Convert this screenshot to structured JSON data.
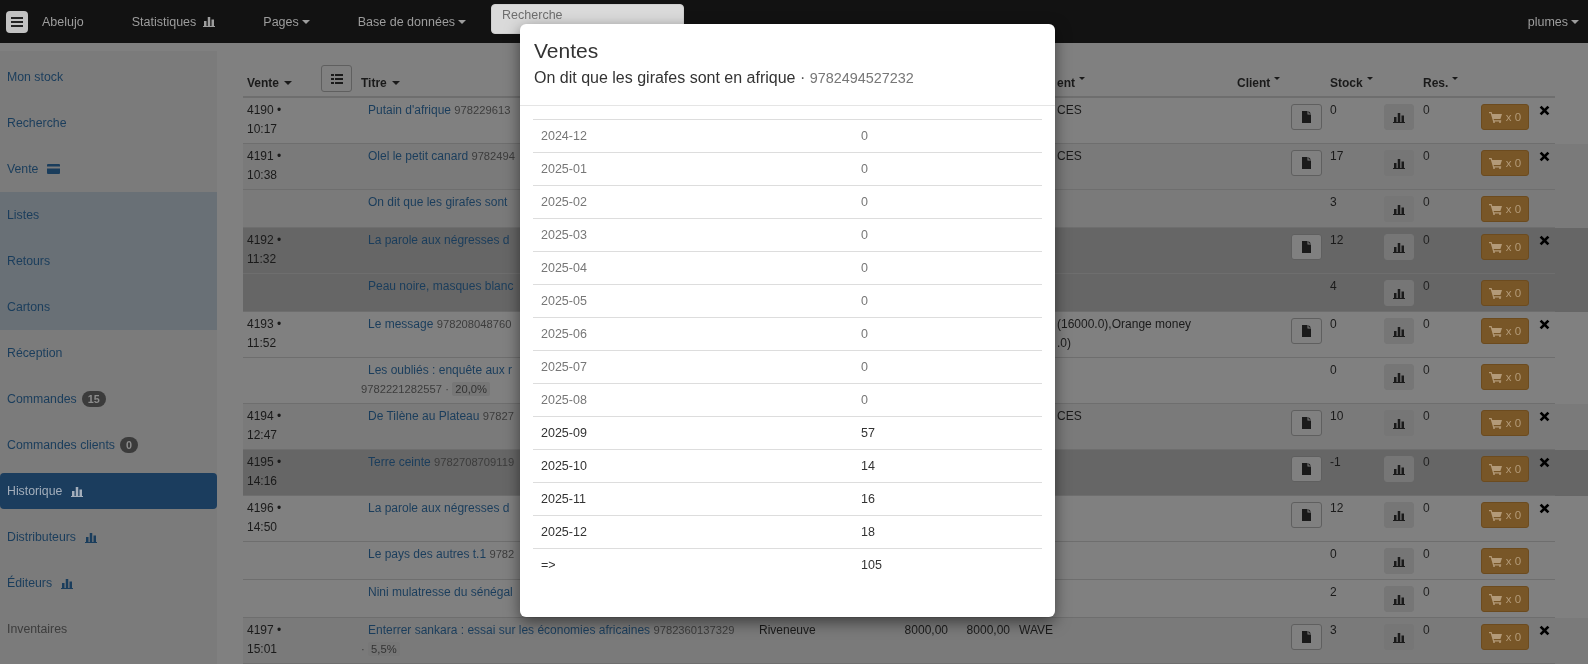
{
  "navbar": {
    "brand": "Abelujo",
    "items": [
      {
        "label": "Statistiques",
        "kind": "stats"
      },
      {
        "label": "Pages",
        "kind": "dropdown"
      },
      {
        "label": "Base de données",
        "kind": "dropdown"
      }
    ],
    "search": {
      "placeholder": "Recherche"
    },
    "user": {
      "label": "plumes"
    }
  },
  "sidebar": {
    "sections": [
      {
        "highlighted": false,
        "items": [
          {
            "label": "Mon stock",
            "kind": "plain",
            "selected": false,
            "disabled": false
          },
          {
            "label": "Recherche",
            "kind": "plain",
            "selected": false,
            "disabled": false
          },
          {
            "label": "Vente",
            "kind": "payment",
            "selected": false,
            "disabled": false
          }
        ]
      },
      {
        "highlighted": true,
        "items": [
          {
            "label": "Listes",
            "kind": "plain",
            "selected": false,
            "disabled": false
          },
          {
            "label": "Retours",
            "kind": "plain",
            "selected": false,
            "disabled": false
          },
          {
            "label": "Cartons",
            "kind": "plain",
            "selected": false,
            "disabled": false
          }
        ]
      },
      {
        "highlighted": false,
        "items": [
          {
            "label": "Réception",
            "kind": "plain",
            "selected": false,
            "disabled": false
          },
          {
            "label": "Commandes",
            "kind": "plain",
            "selected": false,
            "disabled": false,
            "badge": "15"
          },
          {
            "label": "Commandes clients",
            "kind": "plain",
            "selected": false,
            "disabled": false,
            "badge": "0"
          },
          {
            "label": "Historique",
            "kind": "stats",
            "selected": true,
            "disabled": false
          },
          {
            "label": "Distributeurs",
            "kind": "stats",
            "selected": false,
            "disabled": false
          },
          {
            "label": "Éditeurs",
            "kind": "stats",
            "selected": false,
            "disabled": false
          },
          {
            "label": "Inventaires",
            "kind": "plain",
            "selected": false,
            "disabled": true
          }
        ]
      }
    ]
  },
  "table": {
    "columns": [
      {
        "label": "Vente",
        "kind": "menu"
      },
      {
        "kind": "toggle"
      },
      {
        "label": "Titre",
        "kind": "menu"
      },
      {
        "label": "ent",
        "kind": "sort"
      },
      {
        "label": "Client",
        "kind": "sort"
      },
      {
        "label": "Stock",
        "kind": "sort"
      },
      {
        "label": "Res.",
        "kind": "sort"
      }
    ],
    "sales": [
      {
        "label": "4190 • 10:17",
        "color": "#808080",
        "payment": "CES",
        "items": [
          {
            "title": "Putain d'afrique",
            "isbn": "978229613",
            "stock": "0",
            "reserved": "0",
            "cart": "x 0"
          }
        ]
      },
      {
        "label": "4191 • 10:38",
        "color": "#7a7a7a",
        "payment": "CES",
        "items": [
          {
            "title": "Olel le petit canard",
            "isbn": "9782494",
            "stock": "17",
            "reserved": "0",
            "cart": "x 0"
          },
          {
            "title": "On dit que les girafes sont",
            "stock": "3",
            "reserved": "0",
            "cart": "x 0"
          }
        ]
      },
      {
        "label": "4192 • 11:32",
        "color": "#666666",
        "items": [
          {
            "title": "La parole aux négresses d",
            "stock": "12",
            "reserved": "0",
            "cart": "x 0"
          },
          {
            "title": "Peau noire, masques blanc",
            "stock": "4",
            "reserved": "0",
            "cart": "x 0"
          }
        ]
      },
      {
        "label": "4193 • 11:52",
        "color": "#808080",
        "payment": "(16000.0),Orange money\n.0)",
        "items": [
          {
            "title": "Le message",
            "isbn": "978208048760",
            "stock": "0",
            "reserved": "0",
            "cart": "x 0"
          },
          {
            "title": "Les oubliés : enquête aux r",
            "isbn": "9782221282557",
            "separator": "·",
            "discount": "20,0%",
            "stock": "0",
            "reserved": "0",
            "cart": "x 0"
          }
        ]
      },
      {
        "label": "4194 • 12:47",
        "color": "#7a7a7a",
        "payment": "CES",
        "items": [
          {
            "title": "De Tilène au Plateau",
            "isbn": "97827",
            "stock": "10",
            "reserved": "0",
            "cart": "x 0"
          }
        ]
      },
      {
        "label": "4195 • 14:16",
        "color": "#666666",
        "items": [
          {
            "title": "Terre ceinte",
            "isbn": "9782708709119",
            "stock": "-1",
            "reserved": "0",
            "cart": "x 0"
          }
        ]
      },
      {
        "label": "4196 • 14:50",
        "color": "#808080",
        "items": [
          {
            "title": "La parole aux négresses d",
            "stock": "12",
            "reserved": "0",
            "cart": "x 0"
          },
          {
            "title": "Le pays des autres t.1",
            "isbn": "9782",
            "stock": "0",
            "reserved": "0",
            "cart": "x 0"
          },
          {
            "title": "Nini mulatresse du sénégal",
            "stock": "2",
            "reserved": "0",
            "cart": "x 0"
          }
        ]
      },
      {
        "label": "4197 • 15:01",
        "color": "#7a7a7a",
        "publisher": "Riveneuve",
        "price": "8000,00",
        "total": "8000,00",
        "payment": "WAVE",
        "items": [
          {
            "title": "Enterrer sankara : essai sur les économies africaines",
            "isbn": "9782360137329",
            "separator": "·",
            "discount": "5,5%",
            "stock": "3",
            "reserved": "0",
            "cart": "x 0"
          }
        ]
      }
    ]
  },
  "modal": {
    "title": "Ventes",
    "subtitle": {
      "title": "On dit que les girafes sont en afrique",
      "separator": "·",
      "isbn": "9782494527232"
    },
    "rows": [
      {
        "month": "2024-12",
        "count": "0",
        "muted": true
      },
      {
        "month": "2025-01",
        "count": "0",
        "muted": true
      },
      {
        "month": "2025-02",
        "count": "0",
        "muted": true
      },
      {
        "month": "2025-03",
        "count": "0",
        "muted": true
      },
      {
        "month": "2025-04",
        "count": "0",
        "muted": true
      },
      {
        "month": "2025-05",
        "count": "0",
        "muted": true
      },
      {
        "month": "2025-06",
        "count": "0",
        "muted": true
      },
      {
        "month": "2025-07",
        "count": "0",
        "muted": true
      },
      {
        "month": "2025-08",
        "count": "0",
        "muted": true
      },
      {
        "month": "2025-09",
        "count": "57",
        "muted": false
      },
      {
        "month": "2025-10",
        "count": "14",
        "muted": false
      },
      {
        "month": "2025-11",
        "count": "16",
        "muted": false
      },
      {
        "month": "2025-12",
        "count": "18",
        "muted": false
      },
      {
        "month": "=>",
        "count": "105",
        "muted": false
      }
    ]
  }
}
